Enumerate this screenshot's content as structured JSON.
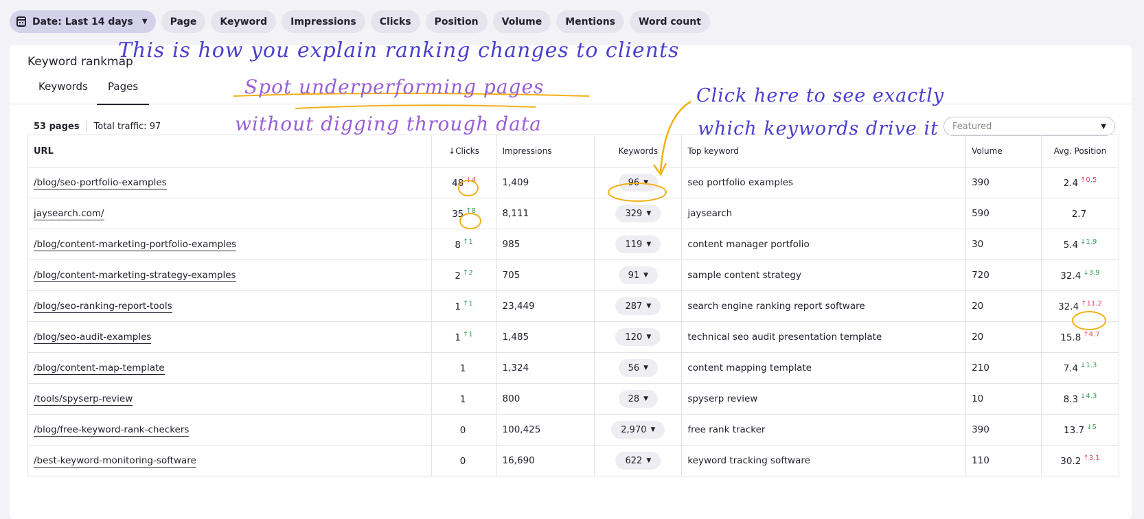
{
  "filters": {
    "date_label": "Date: Last 14 days",
    "chips": [
      "Page",
      "Keyword",
      "Impressions",
      "Clicks",
      "Position",
      "Volume",
      "Mentions",
      "Word count"
    ]
  },
  "card": {
    "title": "Keyword rankmap",
    "tabs": [
      "Keywords",
      "Pages"
    ],
    "active_tab": "Pages",
    "summary": {
      "pages": "53 pages",
      "traffic": "Total traffic: 97"
    },
    "sort_placeholder": "Featured"
  },
  "table": {
    "headers": {
      "url": "URL",
      "clicks": "Clicks",
      "impressions": "Impressions",
      "keywords": "Keywords",
      "top_keyword": "Top keyword",
      "volume": "Volume",
      "avg_position": "Avg. Position"
    },
    "rows": [
      {
        "url": "/blog/seo-portfolio-examples",
        "clicks": "48",
        "clicks_delta": "↓4",
        "clicks_dir": "down",
        "impressions": "1,409",
        "keywords": "96",
        "top_keyword": "seo portfolio examples",
        "volume": "390",
        "position": "2.4",
        "pos_delta": "↑0.5",
        "pos_dir": "down"
      },
      {
        "url": "jaysearch.com/",
        "clicks": "35",
        "clicks_delta": "↑8",
        "clicks_dir": "up",
        "impressions": "8,111",
        "keywords": "329",
        "top_keyword": "jaysearch",
        "volume": "590",
        "position": "2.7",
        "pos_delta": "",
        "pos_dir": ""
      },
      {
        "url": "/blog/content-marketing-portfolio-examples",
        "clicks": "8",
        "clicks_delta": "↑1",
        "clicks_dir": "up",
        "impressions": "985",
        "keywords": "119",
        "top_keyword": "content manager portfolio",
        "volume": "30",
        "position": "5.4",
        "pos_delta": "↓1.9",
        "pos_dir": "up"
      },
      {
        "url": "/blog/content-marketing-strategy-examples",
        "clicks": "2",
        "clicks_delta": "↑2",
        "clicks_dir": "up",
        "impressions": "705",
        "keywords": "91",
        "top_keyword": "sample content strategy",
        "volume": "720",
        "position": "32.4",
        "pos_delta": "↓3.9",
        "pos_dir": "up"
      },
      {
        "url": "/blog/seo-ranking-report-tools",
        "clicks": "1",
        "clicks_delta": "↑1",
        "clicks_dir": "up",
        "impressions": "23,449",
        "keywords": "287",
        "top_keyword": "search engine ranking report software",
        "volume": "20",
        "position": "32.4",
        "pos_delta": "↑11.2",
        "pos_dir": "down"
      },
      {
        "url": "/blog/seo-audit-examples",
        "clicks": "1",
        "clicks_delta": "↑1",
        "clicks_dir": "up",
        "impressions": "1,485",
        "keywords": "120",
        "top_keyword": "technical seo audit presentation template",
        "volume": "20",
        "position": "15.8",
        "pos_delta": "↑4.7",
        "pos_dir": "down"
      },
      {
        "url": "/blog/content-map-template",
        "clicks": "1",
        "clicks_delta": "",
        "clicks_dir": "",
        "impressions": "1,324",
        "keywords": "56",
        "top_keyword": "content mapping template",
        "volume": "210",
        "position": "7.4",
        "pos_delta": "↓1.3",
        "pos_dir": "up"
      },
      {
        "url": "/tools/spyserp-review",
        "clicks": "1",
        "clicks_delta": "",
        "clicks_dir": "",
        "impressions": "800",
        "keywords": "28",
        "top_keyword": "spyserp review",
        "volume": "10",
        "position": "8.3",
        "pos_delta": "↓4.3",
        "pos_dir": "up"
      },
      {
        "url": "/blog/free-keyword-rank-checkers",
        "clicks": "0",
        "clicks_delta": "",
        "clicks_dir": "",
        "impressions": "100,425",
        "keywords": "2,970",
        "top_keyword": "free rank tracker",
        "volume": "390",
        "position": "13.7",
        "pos_delta": "↓5",
        "pos_dir": "up"
      },
      {
        "url": "/best-keyword-monitoring-software",
        "clicks": "0",
        "clicks_delta": "",
        "clicks_dir": "",
        "impressions": "16,690",
        "keywords": "622",
        "top_keyword": "keyword tracking software",
        "volume": "110",
        "position": "30.2",
        "pos_delta": "↑3.1",
        "pos_dir": "down"
      }
    ]
  },
  "annotations": {
    "line1": "This is how you explain ranking changes to clients",
    "line2": "Spot underperforming pages",
    "line3": "without digging through data",
    "line4": "Click here to see exactly",
    "line5": "which keywords drive it",
    "ink_blue": "#4a3fcf",
    "ink_purple": "#9a5fd6",
    "highlight": "#f2b015"
  }
}
